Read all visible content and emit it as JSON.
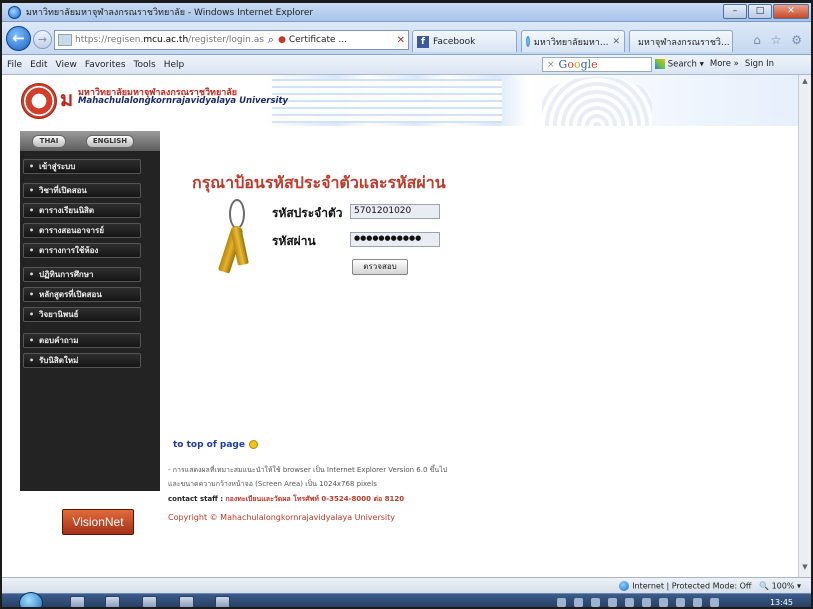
{
  "window": {
    "title": "มหาวิทยาลัยมหาจุฬาลงกรณราชวิทยาลัย - Windows Internet Explorer",
    "minimize": "–",
    "maximize": "□",
    "close": "✕"
  },
  "nav": {
    "back": "←",
    "forward": "→",
    "address_prefix": "https://regisen.",
    "address_host": "mcu.ac.th",
    "address_path": "/register/login.as",
    "certificate": "Certificate ...",
    "tabs": [
      {
        "label": "Facebook",
        "icon": "facebook-icon"
      },
      {
        "label": "มหาวิทยาลัยมหา...",
        "icon": "ie-page-icon"
      },
      {
        "label": "มหาจุฬาลงกรณราชวิ...",
        "icon": "ie-page-icon"
      }
    ],
    "right_icons": "⌂ ☆ ⚙"
  },
  "menu": {
    "items": [
      "File",
      "Edit",
      "View",
      "Favorites",
      "Tools",
      "Help"
    ],
    "google_search": "Google",
    "search": "Search",
    "more": "More »",
    "sign_in": "Sign In"
  },
  "header": {
    "thai_name": "มหาวิทยาลัยมหาจุฬาลงกรณราชวิทยาลัย",
    "english_name": "Mahachulalongkornrajavidyalaya University"
  },
  "sidebar": {
    "thai_button": "THAI",
    "english_button": "ENGLISH",
    "items": [
      "เข้าสู่ระบบ",
      "วิชาที่เปิดสอน",
      "ตารางเรียนนิสิต",
      "ตารางสอนอาจารย์",
      "ตารางการใช้ห้อง",
      "ปฏิทินการศึกษา",
      "หลักสูตรที่เปิดสอน",
      "วิจยานิพนธ์",
      "ตอบคำถาม",
      "รับนิสิตใหม่"
    ],
    "visionnet": "VisionNet"
  },
  "login": {
    "heading": "กรุณาป้อนรหัสประจำตัวและรหัสผ่าน",
    "student_id_label": "รหัสประจำตัว",
    "student_id_value": "5701201020",
    "password_label": "รหัสผ่าน",
    "password_value": "●●●●●●●●●●●",
    "submit_label": "ตรวจสอบ"
  },
  "footer": {
    "top_link": "to top of page",
    "note1": "- การแสดงผลที่เหมาะสมแนะนำให้ใช้ browser เป็น Internet Explorer Version 6.0 ขึ้นไป",
    "note2": "และขนาดความกว้างหน้าจอ (Screen Area) เป็น 1024x768 pixels",
    "contact_label": "contact staff :",
    "contact_text": "กองทะเบียนและวัดผล โทรศัพท์ 0-3524-8000 ต่อ 8120",
    "copyright": "Copyright © Mahachulalongkornrajavidyalaya University"
  },
  "status": {
    "zone": "Internet | Protected Mode: Off",
    "zoom": "100%"
  },
  "taskbar": {
    "clock": "13:45"
  }
}
